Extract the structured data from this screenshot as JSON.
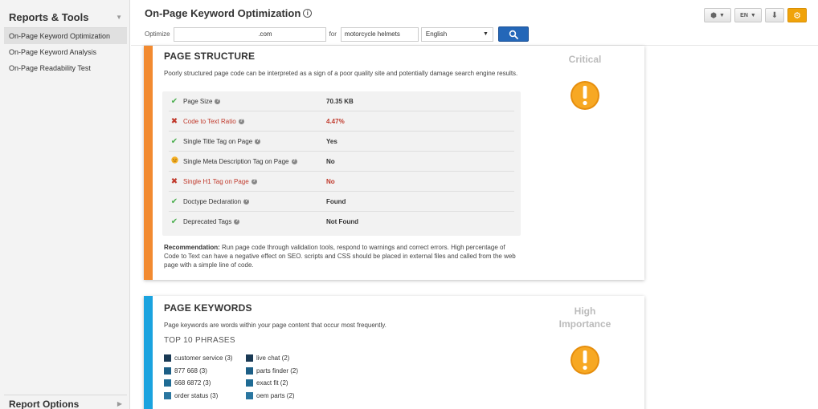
{
  "sidebar": {
    "title": "Reports & Tools",
    "items": [
      {
        "label": "On-Page Keyword Optimization",
        "active": true
      },
      {
        "label": "On-Page Keyword Analysis",
        "active": false
      },
      {
        "label": "On-Page Readability Test",
        "active": false
      }
    ],
    "footer_title": "Report Options"
  },
  "header": {
    "title": "On-Page Keyword Optimization",
    "optimize_label": "Optimize",
    "url_value": ".com",
    "for_label": "for",
    "keyword_value": "motorcycle helmets",
    "language_value": "English",
    "lang_code": "EN"
  },
  "page_structure": {
    "title": "PAGE STRUCTURE",
    "severity": "Critical",
    "description": "Poorly structured page code can be interpreted as a sign of a poor quality site and potentially damage search engine results.",
    "checks": [
      {
        "status": "ok",
        "name": "Page Size",
        "value": "70.35 KB"
      },
      {
        "status": "bad",
        "name": "Code to Text Ratio",
        "value": "4.47%"
      },
      {
        "status": "ok",
        "name": "Single Title Tag on Page",
        "value": "Yes"
      },
      {
        "status": "warn",
        "name": "Single Meta Description Tag on Page",
        "value": "No"
      },
      {
        "status": "bad",
        "name": "Single H1 Tag on Page",
        "value": "No"
      },
      {
        "status": "ok",
        "name": "Doctype Declaration",
        "value": "Found"
      },
      {
        "status": "ok",
        "name": "Deprecated Tags",
        "value": "Not Found"
      }
    ],
    "recommendation_label": "Recommendation:",
    "recommendation_text": " Run page code through validation tools, respond to warnings and correct errors. High percentage of Code to Text can have a negative effect on SEO. scripts and CSS should be placed in external files and called from the web page with a simple line of code."
  },
  "page_keywords": {
    "title": "PAGE KEYWORDS",
    "severity": "High Importance",
    "description": "Page keywords are words within your page content that occur most frequently.",
    "top_label": "TOP 10 PHRASES",
    "col1": [
      "customer service (3)",
      "877 668 (3)",
      "668 6872 (3)",
      "order status (3)"
    ],
    "col2": [
      "live chat (2)",
      "parts finder (2)",
      "exact fit (2)",
      "oem parts (2)"
    ],
    "swatches": [
      "#1a3a55",
      "#1d5f86",
      "#1f6b94",
      "#2a76a0"
    ]
  },
  "colors": {
    "structure_bar": "#f28a30",
    "keywords_bar": "#1aa3df",
    "warn_icon": "#f5a623",
    "search_button": "#2467b8",
    "ok_check": "#4caf50",
    "bad_cross": "#c0392b"
  }
}
